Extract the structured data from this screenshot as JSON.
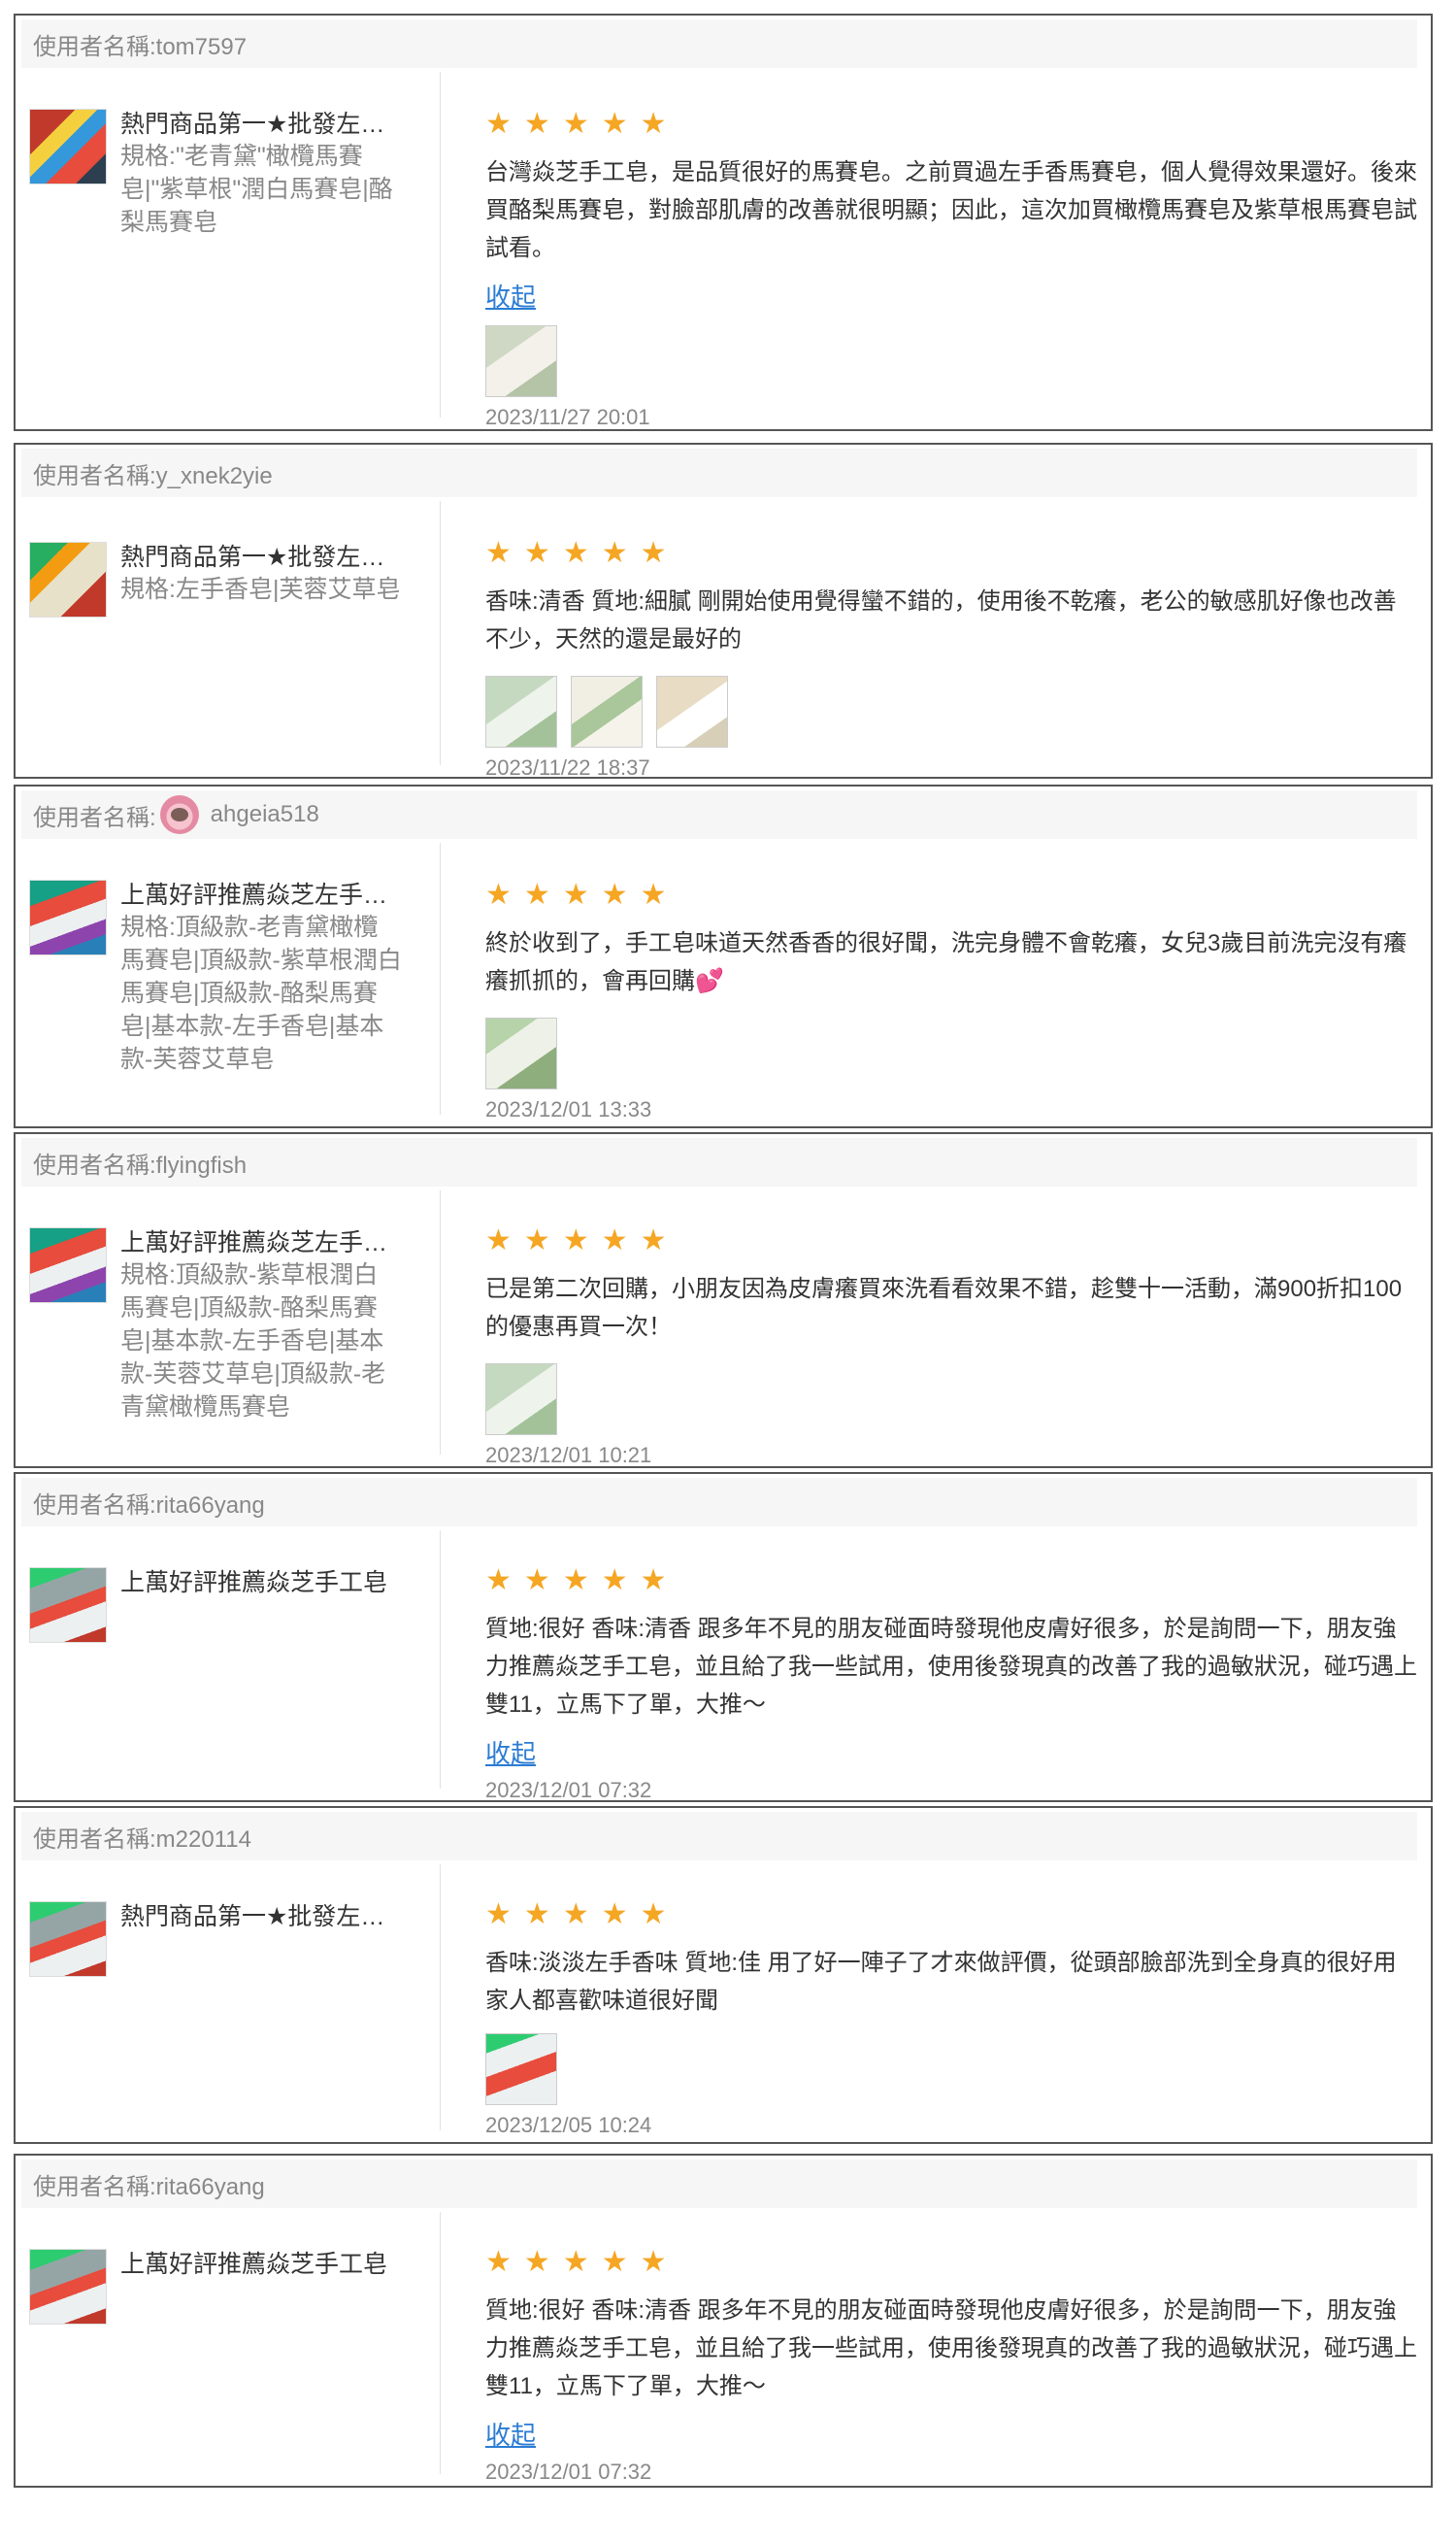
{
  "reviews": [
    {
      "user": "使用者名稱:tom7597",
      "product_name": "熱門商品第一★批發左手香馬賽皂",
      "product_spec": "規格:\"老青黛\"橄欖馬賽皂|\"紫草根\"潤白馬賽皂|酪梨馬賽皂",
      "stars": 5,
      "comment": "台灣焱芝手工皂，是品質很好的馬賽皂。之前買過左手香馬賽皂，個人覺得效果還好。後來買酪梨馬賽皂，對臉部肌膚的改善就很明顯；因此，這次加買橄欖馬賽皂及紫草根馬賽皂試試看。",
      "collapse_label": "收起",
      "date": "2023/11/27 20:01"
    },
    {
      "user": "使用者名稱:y_xnek2yie",
      "product_name": "熱門商品第一★批發左手香馬賽皂",
      "product_spec": "規格:左手香皂|芙蓉艾草皂",
      "stars": 5,
      "comment": "香味:清香 質地:細膩 剛開始使用覺得蠻不錯的，使用後不乾癢，老公的敏感肌好像也改善不少，天然的還是最好的",
      "date": "2023/11/22 18:37"
    },
    {
      "user_label": "使用者名稱:",
      "user": "ahgeia518",
      "product_name": "上萬好評推薦焱芝左手香手工皂",
      "product_spec": "規格:頂級款-老青黛橄欖馬賽皂|頂級款-紫草根潤白馬賽皂|頂級款-酪梨馬賽皂|基本款-左手香皂|基本款-芙蓉艾草皂",
      "stars": 5,
      "comment": "終於收到了，手工皂味道天然香香的很好聞，洗完身體不會乾癢，女兒3歲目前洗完沒有癢癢抓抓的，會再回購",
      "emoji": "💕",
      "date": "2023/12/01 13:33"
    },
    {
      "user": "使用者名稱:flyingfish",
      "product_name": "上萬好評推薦焱芝左手香手工皂",
      "product_spec": "規格:頂級款-紫草根潤白馬賽皂|頂級款-酪梨馬賽皂|基本款-左手香皂|基本款-芙蓉艾草皂|頂級款-老青黛橄欖馬賽皂",
      "stars": 5,
      "comment": "已是第二次回購，小朋友因為皮膚癢買來洗看看效果不錯，趁雙十一活動，滿900折扣100的優惠再買一次！",
      "date": "2023/12/01 10:21"
    },
    {
      "user": "使用者名稱:rita66yang",
      "product_name": "上萬好評推薦焱芝手工皂",
      "stars": 5,
      "comment": "質地:很好 香味:清香 跟多年不見的朋友碰面時發現他皮膚好很多，於是詢問一下，朋友強力推薦焱芝手工皂，並且給了我一些試用，使用後發現真的改善了我的過敏狀況，碰巧遇上雙11，立馬下了單，大推～",
      "collapse_label": "收起",
      "date": "2023/12/01 07:32"
    },
    {
      "user": "使用者名稱:m220114",
      "product_name": "熱門商品第一★批發左手香馬賽皂",
      "stars": 5,
      "comment": "香味:淡淡左手香味 質地:佳 用了好一陣子了才來做評價，從頭部臉部洗到全身真的很好用家人都喜歡味道很好聞",
      "date": "2023/12/05 10:24"
    },
    {
      "user": "使用者名稱:rita66yang",
      "product_name": "上萬好評推薦焱芝手工皂",
      "stars": 5,
      "comment": "質地:很好 香味:清香 跟多年不見的朋友碰面時發現他皮膚好很多，於是詢問一下，朋友強力推薦焱芝手工皂，並且給了我一些試用，使用後發現真的改善了我的過敏狀況，碰巧遇上雙11，立馬下了單，大推～",
      "collapse_label": "收起",
      "date": "2023/12/01 07:32"
    }
  ],
  "star_glyph": "★",
  "colors": {
    "star": "#f5a623",
    "link": "#2b7cd3",
    "border": "#555555"
  }
}
